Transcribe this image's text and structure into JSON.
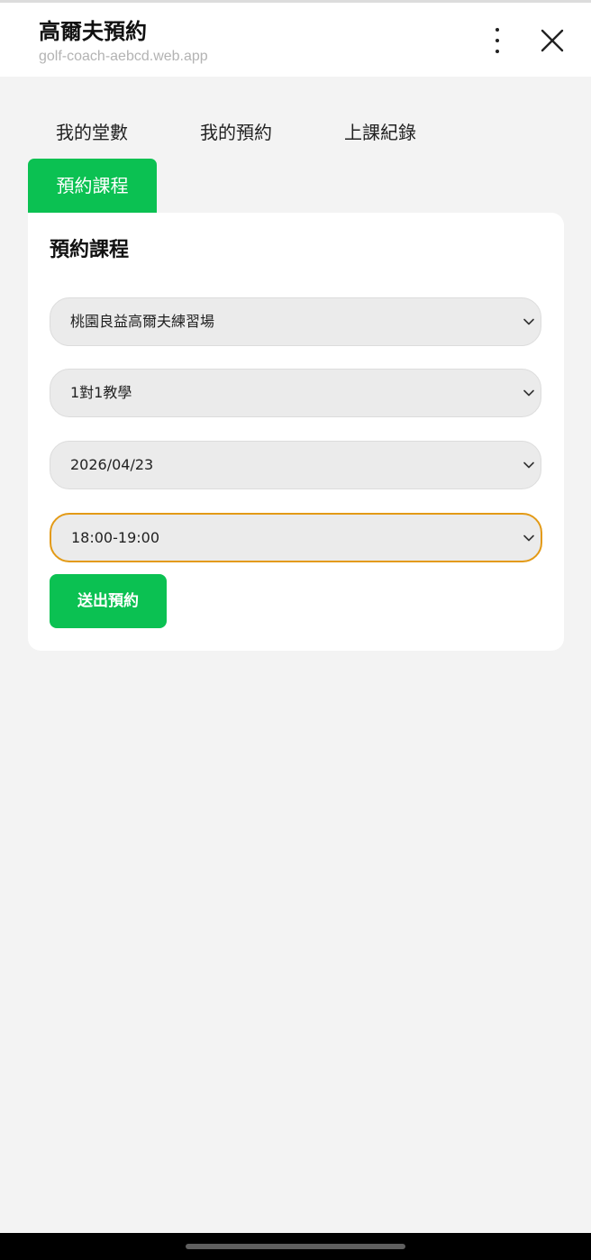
{
  "header": {
    "title": "高爾夫預約",
    "url": "golf-coach-aebcd.web.app"
  },
  "tabs": [
    {
      "label": "我的堂數"
    },
    {
      "label": "我的預約"
    },
    {
      "label": "上課紀錄"
    },
    {
      "label": "預約課程",
      "active": true
    }
  ],
  "booking": {
    "title": "預約課程",
    "venue": "桃園良益高爾夫練習場",
    "lesson_type": "1對1教學",
    "date": "2026/04/23",
    "time_slot": "18:00-19:00",
    "submit_label": "送出預約"
  },
  "colors": {
    "accent": "#0bc152",
    "focus_border": "#e39a16",
    "background": "#f3f3f3"
  }
}
